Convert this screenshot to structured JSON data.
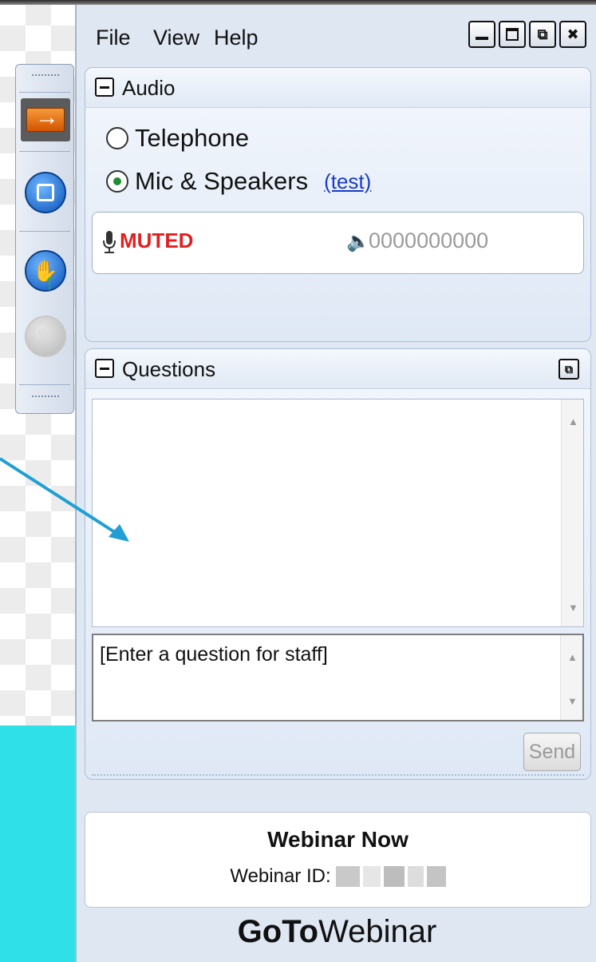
{
  "menu": {
    "file": "File",
    "view": "View",
    "help": "Help"
  },
  "window_controls": {
    "minimize": "minimize-icon",
    "maximize": "maximize-icon",
    "restore": "restore-icon",
    "close": "close-icon"
  },
  "toolbar": {
    "items": [
      "arrow-right-icon",
      "screen-share-icon",
      "raise-hand-icon",
      "draw-tool-icon"
    ]
  },
  "audio": {
    "title": "Audio",
    "options": [
      {
        "label": "Telephone",
        "selected": false
      },
      {
        "label": "Mic & Speakers",
        "selected": true
      }
    ],
    "test_link": "(test)",
    "mic_status": "MUTED",
    "speaker_level": "0000000000"
  },
  "questions": {
    "title": "Questions",
    "input_placeholder": "[Enter a question for staff]",
    "send_label": "Send"
  },
  "webinar": {
    "name": "Webinar Now",
    "id_label": "Webinar ID:"
  },
  "brand": {
    "bold": "GoTo",
    "regular": "Webinar"
  },
  "colors": {
    "muted": "#e02020",
    "link": "#1a3cc8",
    "annotation_arrow": "#1f9fd4",
    "band": "#2fe0e8"
  }
}
